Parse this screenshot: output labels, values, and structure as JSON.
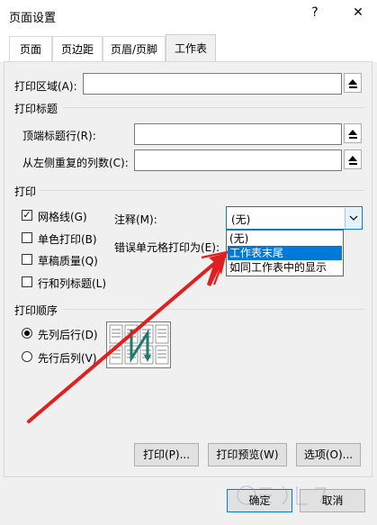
{
  "window": {
    "title": "页面设置",
    "help_label": "?",
    "close_label": "✕"
  },
  "tabs": [
    {
      "label": "页面",
      "active": false
    },
    {
      "label": "页边距",
      "active": false
    },
    {
      "label": "页眉/页脚",
      "active": false
    },
    {
      "label": "工作表",
      "active": true
    }
  ],
  "print_area": {
    "label": "打印区域(A):",
    "value": ""
  },
  "print_titles": {
    "heading": "打印标题",
    "top_rows_label": "顶端标题行(R):",
    "top_rows_value": "",
    "left_cols_label": "从左侧重复的列数(C):",
    "left_cols_value": ""
  },
  "print_section": {
    "heading": "打印",
    "gridlines": {
      "label": "网格线(G)",
      "checked": true
    },
    "mono": {
      "label": "单色打印(B)",
      "checked": false
    },
    "draft": {
      "label": "草稿质量(Q)",
      "checked": false
    },
    "headings": {
      "label": "行和列标题(L)",
      "checked": false
    },
    "comments_label": "注释(M):",
    "comments_value": "(无)",
    "errors_label": "错误单元格打印为(E):",
    "dropdown_options": [
      {
        "label": "(无)",
        "selected": false
      },
      {
        "label": "工作表末尾",
        "selected": true
      },
      {
        "label": "如同工作表中的显示",
        "selected": false
      }
    ]
  },
  "page_order": {
    "heading": "打印顺序",
    "down_then_over": {
      "label": "先列后行(D)",
      "selected": true
    },
    "over_then_down": {
      "label": "先行后列(V)",
      "selected": false
    }
  },
  "buttons": {
    "print": "打印(P)...",
    "preview": "打印预览(W)",
    "options": "选项(O)...",
    "ok": "确定",
    "cancel": "取消"
  },
  "colors": {
    "accent": "#0078d7",
    "annotation_arrow": "#e02020"
  }
}
